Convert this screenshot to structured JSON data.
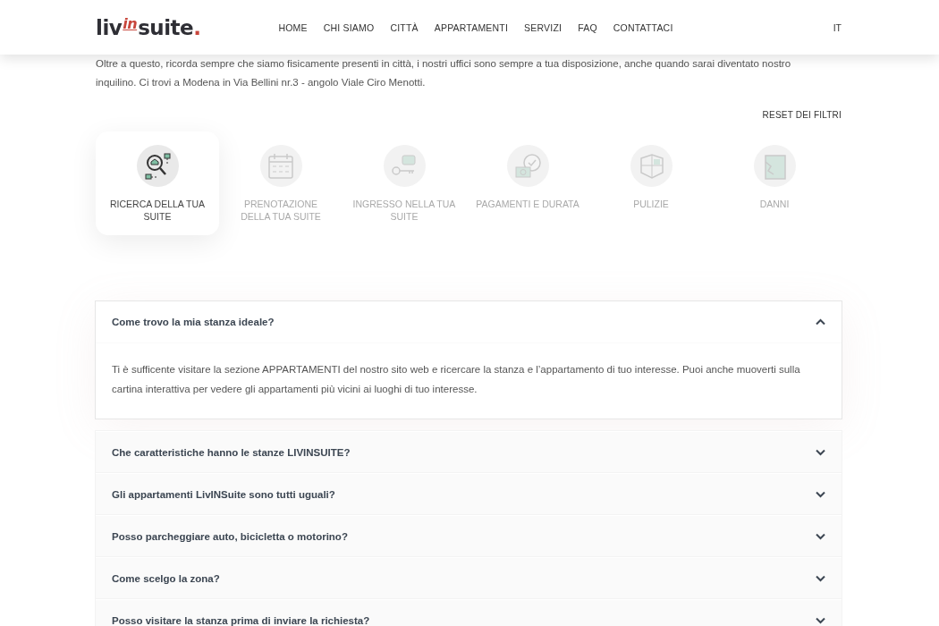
{
  "header": {
    "logo": {
      "part_1": "liv",
      "part_2": "in",
      "part_3": "suite",
      "part_4": "."
    },
    "nav": [
      "HOME",
      "CHI SIAMO",
      "CITTÀ",
      "APPARTAMENTI",
      "SERVIZI",
      "FAQ",
      "CONTATTACI"
    ],
    "language": "IT"
  },
  "intro": [
    "Oltre a questo, ricorda sempre che siamo fisicamente presenti in città, i nostri uffici sono sempre a tua disposizione, anche quando sarai diventato nostro",
    "inquilino. Ci trovi a Modena in Via Bellini nr.3 - angolo Viale Ciro Menotti."
  ],
  "reset_filters": "RESET DEI FILTRI",
  "categories": [
    {
      "label": "RICERCA DELLA TUA SUITE",
      "selected": true
    },
    {
      "label": "PRENOTAZIONE DELLA TUA SUITE",
      "selected": false
    },
    {
      "label": "INGRESSO NELLA TUA SUITE",
      "selected": false
    },
    {
      "label": "PAGAMENTI E DURATA",
      "selected": false
    },
    {
      "label": "PULIZIE",
      "selected": false
    },
    {
      "label": "DANNI",
      "selected": false
    }
  ],
  "faq": [
    {
      "question": "Come trovo la mia stanza ideale?",
      "expanded": true,
      "answer": "Ti è sufficente visitare la sezione APPARTAMENTI del nostro sito web e ricercare la stanza e l’appartamento di tuo interesse. Puoi anche muoverti sulla cartina interattiva per vedere gli appartamenti più vicini ai luoghi di tuo interesse."
    },
    {
      "question": "Che caratteristiche hanno le stanze LIVINSUITE?",
      "expanded": false
    },
    {
      "question": "Gli appartamenti LivINSuite sono tutti uguali?",
      "expanded": false
    },
    {
      "question": "Posso parcheggiare auto, bicicletta o motorino?",
      "expanded": false
    },
    {
      "question": "Come scelgo la zona?",
      "expanded": false
    },
    {
      "question": "Posso visitare la stanza prima di inviare la richiesta?",
      "expanded": false
    }
  ]
}
